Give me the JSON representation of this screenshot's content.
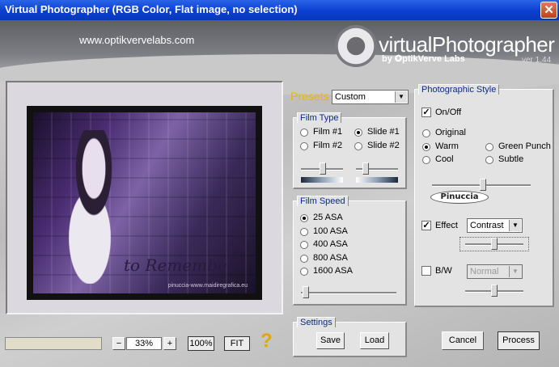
{
  "window": {
    "title": "Virtual Photographer (RGB Color, Flat image, no selection)",
    "close_label": "✕"
  },
  "header": {
    "url": "www.optikvervelabs.com",
    "brand_name": "virtualPhotographer",
    "brand_by": "by ✪ptikVerve Labs",
    "version": "ver 1.44"
  },
  "preview": {
    "watermark": "pinuccia-www.maidiregrafica.eu",
    "script_text": "to Remember"
  },
  "zoom": {
    "minus": "−",
    "value": "33%",
    "plus": "+",
    "hundred": "100%",
    "fit": "FIT",
    "help": "?"
  },
  "presets": {
    "label": "Presets",
    "selected": "Custom"
  },
  "film_type": {
    "title": "Film Type",
    "options": [
      {
        "label": "Film #1",
        "selected": false
      },
      {
        "label": "Slide #1",
        "selected": true
      },
      {
        "label": "Film #2",
        "selected": false
      },
      {
        "label": "Slide #2",
        "selected": false
      }
    ]
  },
  "film_speed": {
    "title": "Film Speed",
    "options": [
      {
        "label": "25 ASA",
        "selected": true
      },
      {
        "label": "100 ASA",
        "selected": false
      },
      {
        "label": "400 ASA",
        "selected": false
      },
      {
        "label": "800 ASA",
        "selected": false
      },
      {
        "label": "1600 ASA",
        "selected": false
      }
    ]
  },
  "settings": {
    "title": "Settings",
    "save": "Save",
    "load": "Load"
  },
  "photographic_style": {
    "title": "Photographic Style",
    "on_off": {
      "label": "On/Off",
      "checked": true
    },
    "styles": [
      {
        "label": "Original",
        "selected": false
      },
      {
        "label": "Warm",
        "selected": true
      },
      {
        "label": "Green Punch",
        "selected": false
      },
      {
        "label": "Cool",
        "selected": false
      },
      {
        "label": "Subtle",
        "selected": false
      }
    ],
    "signature": "Pinuccia",
    "effect": {
      "label": "Effect",
      "checked": true,
      "selected": "Contrast"
    },
    "bw": {
      "label": "B/W",
      "checked": false,
      "selected": "Normal"
    }
  },
  "actions": {
    "cancel": "Cancel",
    "process": "Process"
  },
  "colors": {
    "accent_title": "#0a2a8a",
    "presets_label": "#e8b800",
    "titlebar": "#0a3fd0"
  }
}
